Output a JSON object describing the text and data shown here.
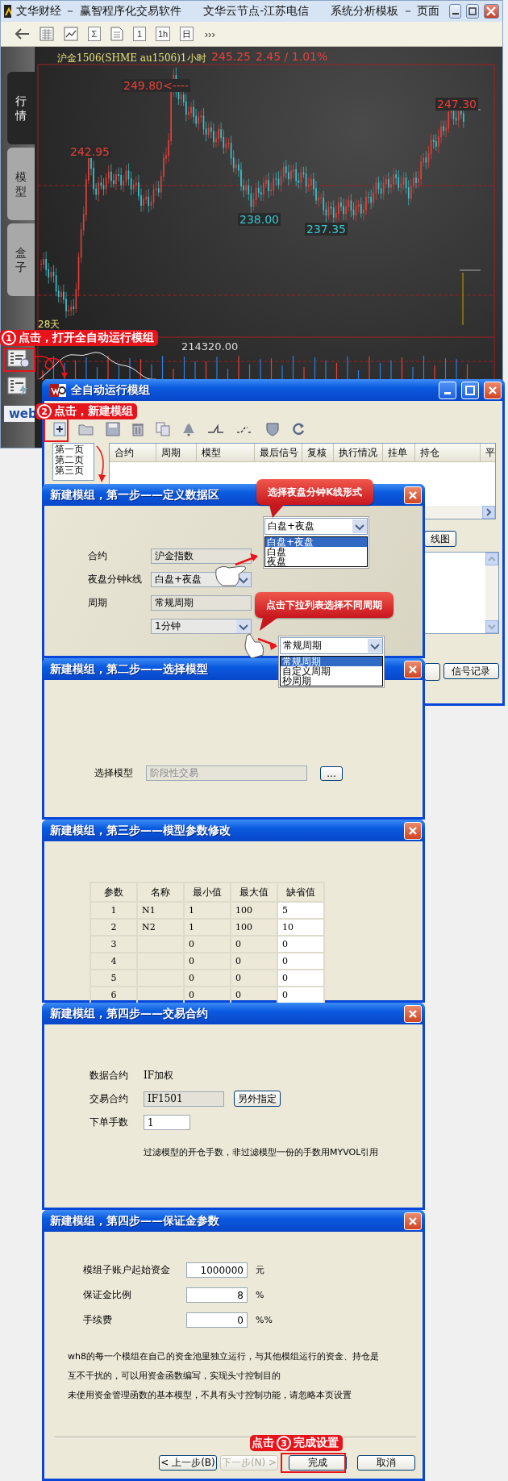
{
  "main_window": {
    "title": [
      "文华财经 － 赢智程序化交易软件",
      "文华云节点-江苏电信",
      "系统分析模板 － 页面"
    ],
    "toolbar": [
      {
        "kind": "back"
      },
      {
        "kind": "grid"
      },
      {
        "kind": "chart"
      },
      {
        "kind": "glyph",
        "label": "Σ"
      },
      {
        "kind": "doc"
      },
      {
        "kind": "glyph",
        "label": "1"
      },
      {
        "kind": "glyph",
        "label": "1h"
      },
      {
        "kind": "glyph",
        "label": "日"
      },
      {
        "kind": "more",
        "label": "›››"
      }
    ],
    "side_tabs": [
      {
        "label": "行情",
        "selected": true
      },
      {
        "label": "模型",
        "selected": false
      },
      {
        "label": "盒子",
        "selected": false
      }
    ],
    "chart": {
      "header": "沪金1506(SHME au1506)1小时",
      "price": "245.25",
      "change": "2.45 / 1.01%",
      "marks": [
        {
          "text": "249.80<----",
          "kind": "high"
        },
        {
          "text": "242.95",
          "kind": "high"
        },
        {
          "text": "238.00",
          "kind": "low"
        },
        {
          "text": "237.35",
          "kind": "low"
        },
        {
          "text": "247.30",
          "kind": "high"
        }
      ],
      "period_label": "28天",
      "volume_label": "214320.00"
    },
    "logo": "web"
  },
  "callouts": [
    {
      "number": "1",
      "text": "点击，打开全自动运行模组"
    },
    {
      "number": "2",
      "text": "点击，新建模组"
    },
    {
      "prefix": "点击",
      "number": "3",
      "text": "完成设置"
    }
  ],
  "module_window": {
    "title": "全自动运行模组",
    "pages": [
      "第一页",
      "第二页",
      "第三页"
    ],
    "columns": [
      "合约",
      "周期",
      "模型",
      "最后信号",
      "复核",
      "执行情况",
      "挂单",
      "持仓",
      "平"
    ],
    "chart_button": "线图",
    "signal_button": "信号记录"
  },
  "step1": {
    "title": "新建模组，第一步——定义数据区",
    "fields": [
      {
        "label": "合约",
        "value": "沪金指数",
        "kind": "readonly"
      },
      {
        "label": "夜盘分钟k线",
        "value": "白盘+夜盘",
        "kind": "combo"
      },
      {
        "label": "周期",
        "value": "常规周期",
        "kind": "readonly"
      },
      {
        "value": "1分钟",
        "kind": "combo"
      }
    ],
    "dropdowns": [
      {
        "value": "白盘+夜盘",
        "options": [
          {
            "text": "白盘+夜盘",
            "selected": true
          },
          {
            "text": "白盘",
            "selected": false
          },
          {
            "text": "夜盘",
            "selected": false
          }
        ]
      },
      {
        "value": "常规周期",
        "options": [
          {
            "text": "常规周期",
            "selected": true
          },
          {
            "text": "自定义周期",
            "selected": false
          },
          {
            "text": "秒周期",
            "selected": false
          }
        ]
      }
    ],
    "tips": [
      "选择夜盘分钟K线形式",
      "点击下拉列表选择不同周期"
    ]
  },
  "step2": {
    "title": "新建模组，第二步——选择模型",
    "label": "选择模型",
    "value": "阶段性交易",
    "disabled": true,
    "button": "..."
  },
  "step3": {
    "title": "新建模组，第三步——模型参数修改",
    "columns": [
      "参数",
      "名称",
      "最小值",
      "最大值",
      "缺省值"
    ],
    "rows": [
      {
        "param": "1",
        "name": "N1",
        "min": "1",
        "max": "100",
        "default": "5"
      },
      {
        "param": "2",
        "name": "N2",
        "min": "1",
        "max": "100",
        "default": "10"
      },
      {
        "param": "3",
        "min": "0",
        "max": "0",
        "default": "0"
      },
      {
        "param": "4",
        "min": "0",
        "max": "0",
        "default": "0"
      },
      {
        "param": "5",
        "min": "0",
        "max": "0",
        "default": "0"
      },
      {
        "param": "6",
        "min": "0",
        "max": "0",
        "default": "0"
      }
    ]
  },
  "step4_contract": {
    "title": "新建模组，第四步——交易合约",
    "data_label": "数据合约",
    "data_value": "IF加权",
    "trade_label": "交易合约",
    "trade_value": "IF1501",
    "assign_button": "另外指定",
    "lots_label": "下单手数",
    "lots_value": "1",
    "note": "过滤模型的开仓手数，非过滤模型一份的手数用MYVOL引用"
  },
  "step4_margin": {
    "title": "新建模组，第四步——保证金参数",
    "fields": [
      {
        "label": "模组子账户起始资金",
        "value": "1000000",
        "unit": "元"
      },
      {
        "label": "保证金比例",
        "value": "8",
        "unit": "%"
      },
      {
        "label": "手续费",
        "value": "0",
        "unit": "%%"
      }
    ],
    "notes": [
      "wh8的每一个模组在自己的资金池里独立运行，与其他模组运行的资金、持仓是",
      "互不干扰的，可以用资金函数编写，实现头寸控制目的",
      "未使用资金管理函数的基本模型，不具有头寸控制功能，请忽略本页设置"
    ],
    "buttons": [
      {
        "label": "< 上一步(B)",
        "disabled": false
      },
      {
        "label": "下一步(N) >",
        "disabled": true
      },
      {
        "label": "完成",
        "disabled": false
      },
      {
        "label": "取消",
        "disabled": false
      }
    ]
  }
}
